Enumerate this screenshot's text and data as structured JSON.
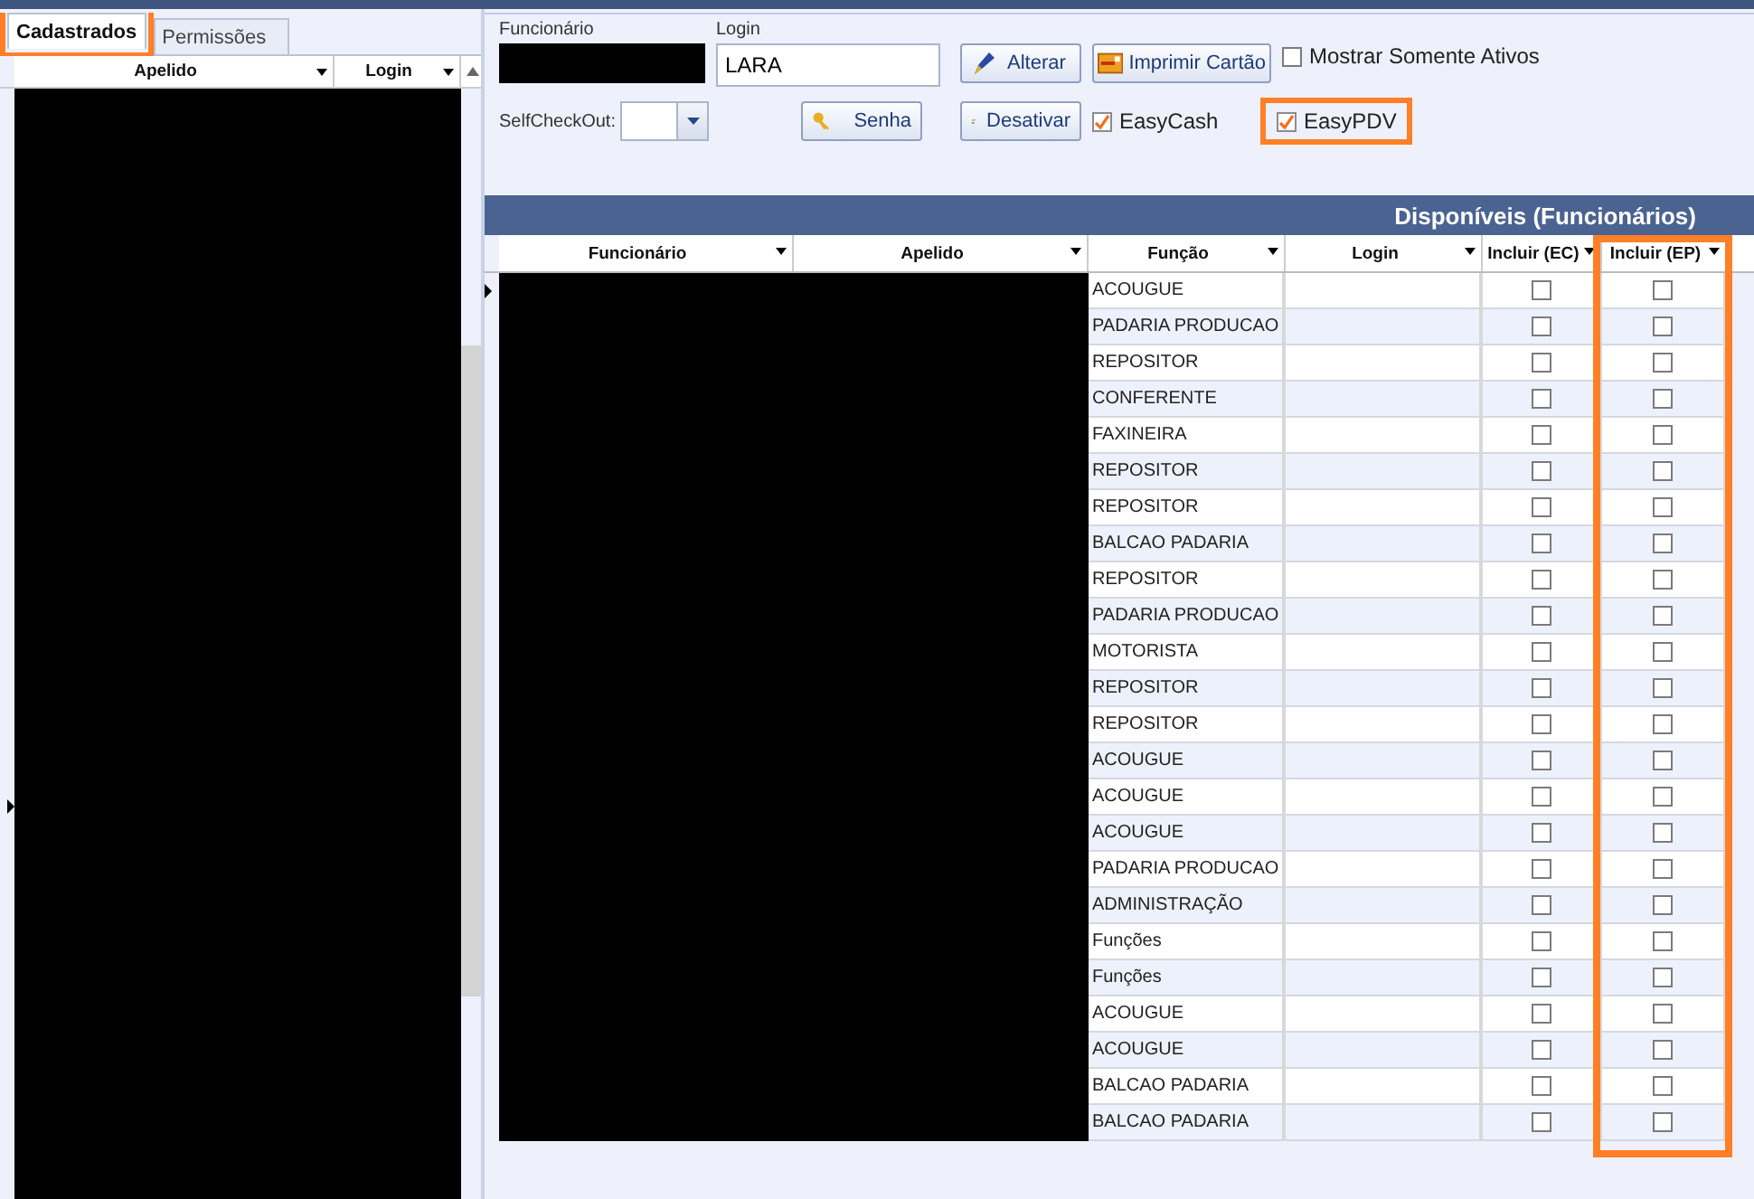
{
  "tabs": [
    {
      "label": "Cadastrados",
      "selected": true,
      "highlighted": true
    },
    {
      "label": "Permissões",
      "selected": false
    }
  ],
  "left_grid": {
    "columns": [
      "Apelido",
      "Login"
    ]
  },
  "form": {
    "funcionario_label": "Funcionário",
    "login_label": "Login",
    "login_value": "LARA",
    "selfcheckout_label": "SelfCheckOut:",
    "buttons": [
      {
        "label": "Alterar"
      },
      {
        "label": "Imprimir Cartão"
      },
      {
        "label": "Senha"
      },
      {
        "label": "Desativar"
      }
    ],
    "checkboxes": [
      {
        "label": "Mostrar Somente Ativos",
        "checked": false
      },
      {
        "label": "EasyCash",
        "checked": true
      },
      {
        "label": "EasyPDV",
        "checked": true,
        "highlighted": true
      }
    ]
  },
  "grid": {
    "title": "Disponíveis (Funcionários)",
    "columns": [
      {
        "label": "Funcionário",
        "highlighted": false
      },
      {
        "label": "Apelido",
        "highlighted": false
      },
      {
        "label": "Função",
        "highlighted": false
      },
      {
        "label": "Login",
        "highlighted": false
      },
      {
        "label": "Incluir (EC)",
        "highlighted": false
      },
      {
        "label": "Incluir (EP)",
        "highlighted": true
      }
    ],
    "rows": [
      {
        "funcao": "ACOUGUE",
        "selected": true,
        "ec": false,
        "ep": false
      },
      {
        "funcao": "PADARIA PRODUCAO",
        "selected": false,
        "ec": false,
        "ep": false
      },
      {
        "funcao": "REPOSITOR",
        "selected": false,
        "ec": false,
        "ep": false
      },
      {
        "funcao": "CONFERENTE",
        "selected": false,
        "ec": false,
        "ep": false
      },
      {
        "funcao": "FAXINEIRA",
        "selected": false,
        "ec": false,
        "ep": false
      },
      {
        "funcao": "REPOSITOR",
        "selected": false,
        "ec": false,
        "ep": false
      },
      {
        "funcao": "REPOSITOR",
        "selected": false,
        "ec": false,
        "ep": false
      },
      {
        "funcao": "BALCAO PADARIA",
        "selected": false,
        "ec": false,
        "ep": false
      },
      {
        "funcao": "REPOSITOR",
        "selected": false,
        "ec": false,
        "ep": false
      },
      {
        "funcao": "PADARIA PRODUCAO",
        "selected": false,
        "ec": false,
        "ep": false
      },
      {
        "funcao": "MOTORISTA",
        "selected": false,
        "ec": false,
        "ep": false
      },
      {
        "funcao": "REPOSITOR",
        "selected": false,
        "ec": false,
        "ep": false
      },
      {
        "funcao": "REPOSITOR",
        "selected": false,
        "ec": false,
        "ep": false
      },
      {
        "funcao": "ACOUGUE",
        "selected": false,
        "ec": false,
        "ep": false
      },
      {
        "funcao": "ACOUGUE",
        "selected": false,
        "ec": false,
        "ep": false
      },
      {
        "funcao": "ACOUGUE",
        "selected": false,
        "ec": false,
        "ep": false
      },
      {
        "funcao": "PADARIA PRODUCAO",
        "selected": false,
        "ec": false,
        "ep": false
      },
      {
        "funcao": "ADMINISTRAÇÃO",
        "selected": false,
        "ec": false,
        "ep": false
      },
      {
        "funcao": "Funções",
        "selected": false,
        "ec": false,
        "ep": false
      },
      {
        "funcao": "Funções",
        "selected": false,
        "ec": false,
        "ep": false
      },
      {
        "funcao": "ACOUGUE",
        "selected": false,
        "ec": false,
        "ep": false
      },
      {
        "funcao": "ACOUGUE",
        "selected": false,
        "ec": false,
        "ep": false
      },
      {
        "funcao": "BALCAO PADARIA",
        "selected": false,
        "ec": false,
        "ep": false
      },
      {
        "funcao": "BALCAO PADARIA",
        "selected": false,
        "ec": false,
        "ep": false
      }
    ]
  }
}
